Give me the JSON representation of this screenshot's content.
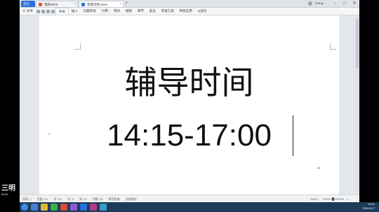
{
  "tabbar": {
    "home_tab": "首页",
    "tab1_label": "我的WPS",
    "tab2_label": "新建文档.docx",
    "new_tab": "+",
    "user_name": "Xiong...",
    "window_controls": [
      "–",
      "□",
      "✕"
    ]
  },
  "menubar": {
    "file": "三 文件",
    "items": [
      "开始",
      "插入",
      "页面布局",
      "引用",
      "审阅",
      "视图",
      "章节",
      "安全",
      "开发工具",
      "特色应用"
    ],
    "active_index": 0,
    "search": "Q查找"
  },
  "document": {
    "line1": "辅导时间",
    "line2": "14:15-17:00"
  },
  "statusbar": {
    "items": [
      "页码: 1",
      "页面: 1/1",
      "节: 1/1",
      "行: 2",
      "列: 12",
      "字数: 15",
      "拼写检查",
      "文档校对"
    ],
    "zoom": "100%"
  },
  "watermark": {
    "main": "三明",
    "sub": "813d..."
  },
  "taskbar": {
    "time": "19:41",
    "date": "2016/11/7"
  },
  "colors": {
    "accent": "#2b6fd6",
    "taskbar": "#1d3b58"
  }
}
